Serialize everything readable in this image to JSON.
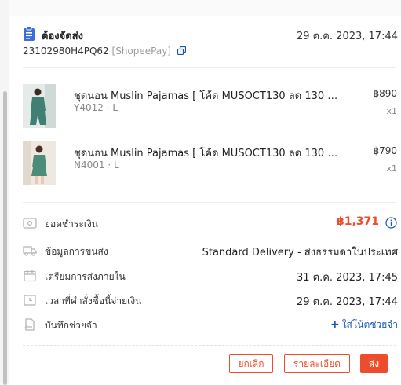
{
  "order": {
    "status": "ต้องจัดส่ง",
    "datetime": "29 ต.ค. 2023, 17:44",
    "order_id": "23102980H4PQ62",
    "payment": "[ShopeePay]"
  },
  "items": [
    {
      "name": "ชุดนอน Muslin Pajamas [ โค้ด MUSOCT130 ลด 130 ฿...",
      "variation": "Y4012 · L",
      "price": "฿890",
      "qty": "x1"
    },
    {
      "name": "ชุดนอน Muslin Pajamas [ โค้ด MUSOCT130 ลด 130 ฿...",
      "variation": "N4001 · L",
      "price": "฿790",
      "qty": "x1"
    }
  ],
  "summary": {
    "total_label": "ยอดชำระเงิน",
    "total_value": "฿1,371",
    "shipping_label": "ข้อมูลการขนส่ง",
    "shipping_value": "Standard Delivery - ส่งธรรมดาในประเทศ",
    "ship_by_label": "เตรียมการส่งภายใน",
    "ship_by_value": "31 ต.ค. 2023, 17:45",
    "order_time_label": "เวลาที่คำสั่งซื้อนี้จ่ายเงิน",
    "order_time_value": "29 ต.ค. 2023, 17:44",
    "note_label": "บันทึกช่วยจำ",
    "note_action": "ใส่โน้ตช่วยจำ"
  },
  "actions": {
    "cancel": "ยกเลิก",
    "details": "รายละเอียด",
    "ship": "ส่ง"
  },
  "colors": {
    "accent": "#ee4d2d",
    "link": "#1a56b4",
    "status_icon": "#3b6fd8"
  },
  "icons": {
    "status": "clipboard-icon",
    "copy": "copy-icon",
    "total": "wallet-icon",
    "shipping": "truck-icon",
    "ship_by": "calendar-icon",
    "order_time": "clock-icon",
    "note": "note-icon",
    "help": "help-icon"
  }
}
